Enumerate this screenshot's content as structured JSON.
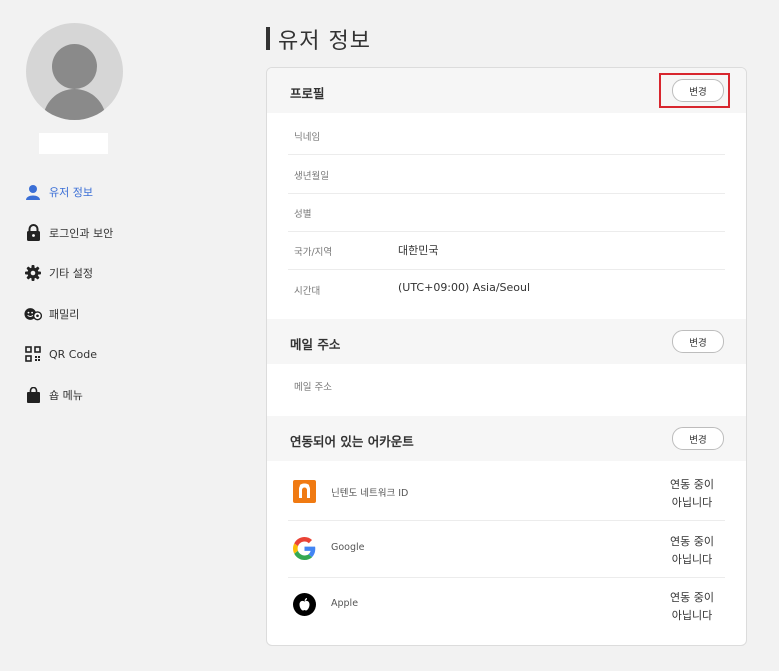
{
  "page": {
    "title": "유저 정보"
  },
  "sidebar": {
    "items": [
      {
        "label": "유저 정보",
        "icon": "user-icon",
        "active": true
      },
      {
        "label": "로그인과 보안",
        "icon": "lock-icon"
      },
      {
        "label": "기타 설정",
        "icon": "gear-icon"
      },
      {
        "label": "패밀리",
        "icon": "family-icon"
      },
      {
        "label": "QR Code",
        "icon": "qr-code-icon"
      },
      {
        "label": "숍 메뉴",
        "icon": "shopping-bag-icon"
      }
    ]
  },
  "profile": {
    "title": "프로필",
    "change_label": "변경",
    "fields": [
      {
        "label": "닉네임",
        "value": ""
      },
      {
        "label": "생년월일",
        "value": ""
      },
      {
        "label": "성별",
        "value": ""
      },
      {
        "label": "국가/지역",
        "value": "대한민국"
      },
      {
        "label": "시간대",
        "value": "(UTC+09:00) Asia/Seoul"
      }
    ]
  },
  "email": {
    "title": "메일 주소",
    "change_label": "변경",
    "fields": [
      {
        "label": "메일 주소",
        "value": ""
      }
    ]
  },
  "linked": {
    "title": "연동되어 있는 어카운트",
    "change_label": "변경",
    "accounts": [
      {
        "name": "닌텐도 네트워크 ID",
        "status_line1": "연동 중이",
        "status_line2": "아닙니다",
        "icon": "nintendo-network-icon"
      },
      {
        "name": "Google",
        "status_line1": "연동 중이",
        "status_line2": "아닙니다",
        "icon": "google-icon"
      },
      {
        "name": "Apple",
        "status_line1": "연동 중이",
        "status_line2": "아닙니다",
        "icon": "apple-icon"
      }
    ]
  },
  "colors": {
    "accent": "#3b6fd6",
    "highlight_border": "#d8262e",
    "nintendo_orange": "#f07a12"
  }
}
